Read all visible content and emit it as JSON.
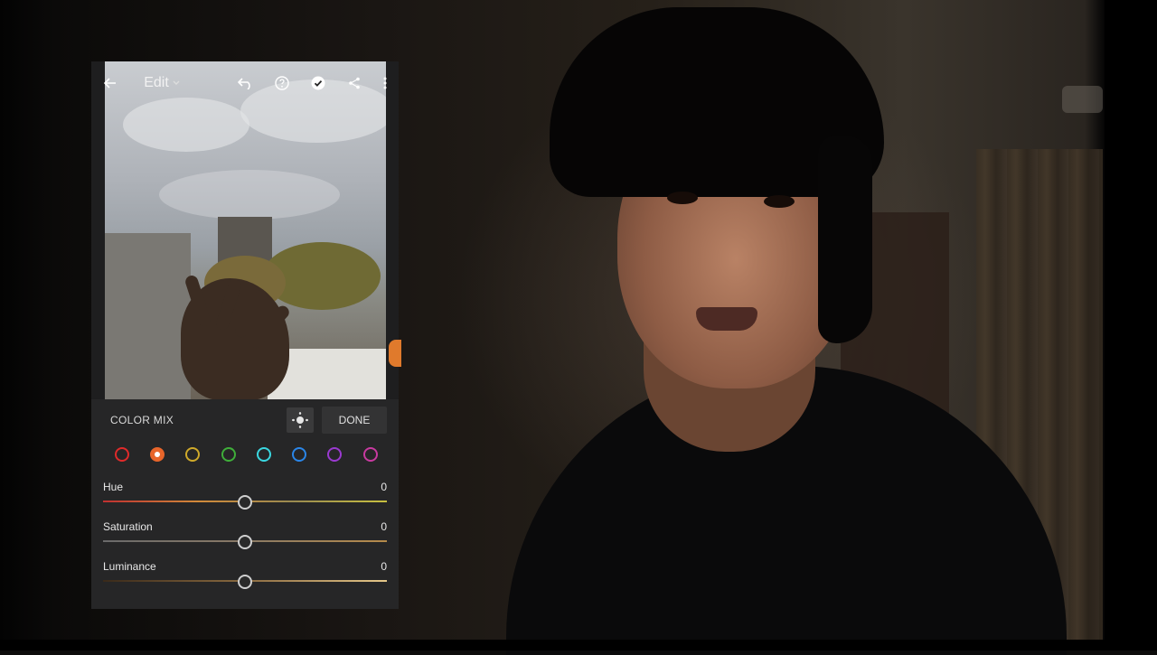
{
  "app": {
    "title": "Edit",
    "toolbar_icons": [
      "back-arrow-icon",
      "undo-icon",
      "help-icon",
      "checkmark-icon",
      "share-icon",
      "more-icon"
    ]
  },
  "panel": {
    "title": "COLOR MIX",
    "done_label": "DONE",
    "swatches": [
      {
        "name": "red",
        "color": "#e02a2a"
      },
      {
        "name": "orange",
        "color": "#e8652a",
        "selected": true
      },
      {
        "name": "yellow",
        "color": "#cfa92a"
      },
      {
        "name": "green",
        "color": "#3fae3a"
      },
      {
        "name": "aqua",
        "color": "#3ad7e0"
      },
      {
        "name": "blue",
        "color": "#2a86e8"
      },
      {
        "name": "purple",
        "color": "#9a3ad0"
      },
      {
        "name": "magenta",
        "color": "#c83aa0"
      }
    ],
    "sliders": [
      {
        "label": "Hue",
        "value": "0"
      },
      {
        "label": "Saturation",
        "value": "0"
      },
      {
        "label": "Luminance",
        "value": "0"
      }
    ]
  },
  "colors": {
    "panel_bg": "#262627",
    "accent_orange": "#e8652a"
  }
}
